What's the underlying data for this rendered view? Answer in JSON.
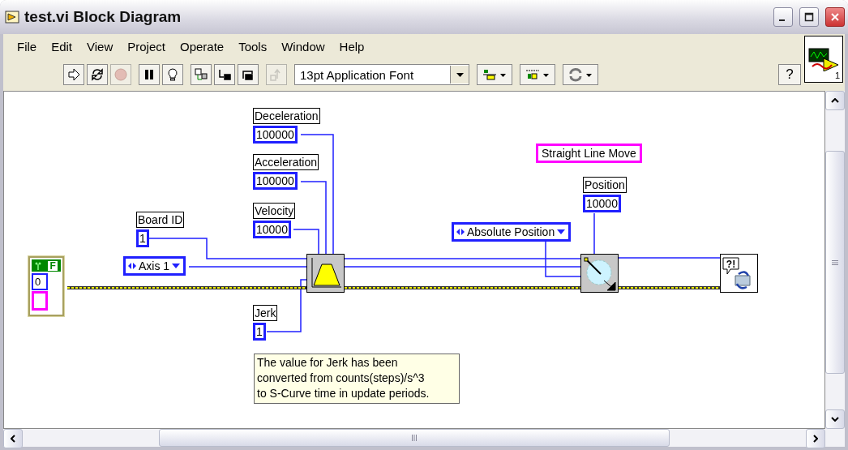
{
  "window": {
    "title": "test.vi Block Diagram"
  },
  "menu": [
    "File",
    "Edit",
    "View",
    "Project",
    "Operate",
    "Tools",
    "Window",
    "Help"
  ],
  "toolbar": {
    "buttons": [
      {
        "kind": "run",
        "disabled": false
      },
      {
        "kind": "run-continuously",
        "disabled": false
      },
      {
        "kind": "abort",
        "disabled": true
      },
      {
        "kind": "pause",
        "disabled": false
      },
      {
        "kind": "highlight",
        "disabled": false
      },
      {
        "kind": "retain",
        "disabled": false
      },
      {
        "kind": "step-into",
        "disabled": false
      },
      {
        "kind": "step-over",
        "disabled": false
      },
      {
        "kind": "step-out",
        "disabled": true
      }
    ],
    "font": "13pt Application Font",
    "help": "?"
  },
  "vi_icon": {
    "text": "1"
  },
  "diagram": {
    "constants": [
      {
        "kind": "numeric",
        "label": "Deceleration",
        "value": "100000"
      },
      {
        "kind": "numeric",
        "label": "Acceleration",
        "value": "100000"
      },
      {
        "kind": "numeric",
        "label": "Velocity",
        "value": "10000"
      },
      {
        "kind": "numeric",
        "label": "Board ID",
        "value": "1"
      },
      {
        "kind": "enum",
        "value": "Axis 1"
      },
      {
        "kind": "numeric",
        "label": "Jerk",
        "value": "1"
      },
      {
        "kind": "numeric",
        "label": "Position",
        "value": "10000"
      },
      {
        "kind": "enum",
        "value": "Absolute Position"
      }
    ],
    "string_constant": "Straight Line Move",
    "case_structure": {
      "selector": "F",
      "index": "0"
    },
    "error_node": {
      "symbol": "?!"
    },
    "note": "The value for Jerk has been converted from counts(steps)/s^3 to S-Curve time in update periods."
  }
}
